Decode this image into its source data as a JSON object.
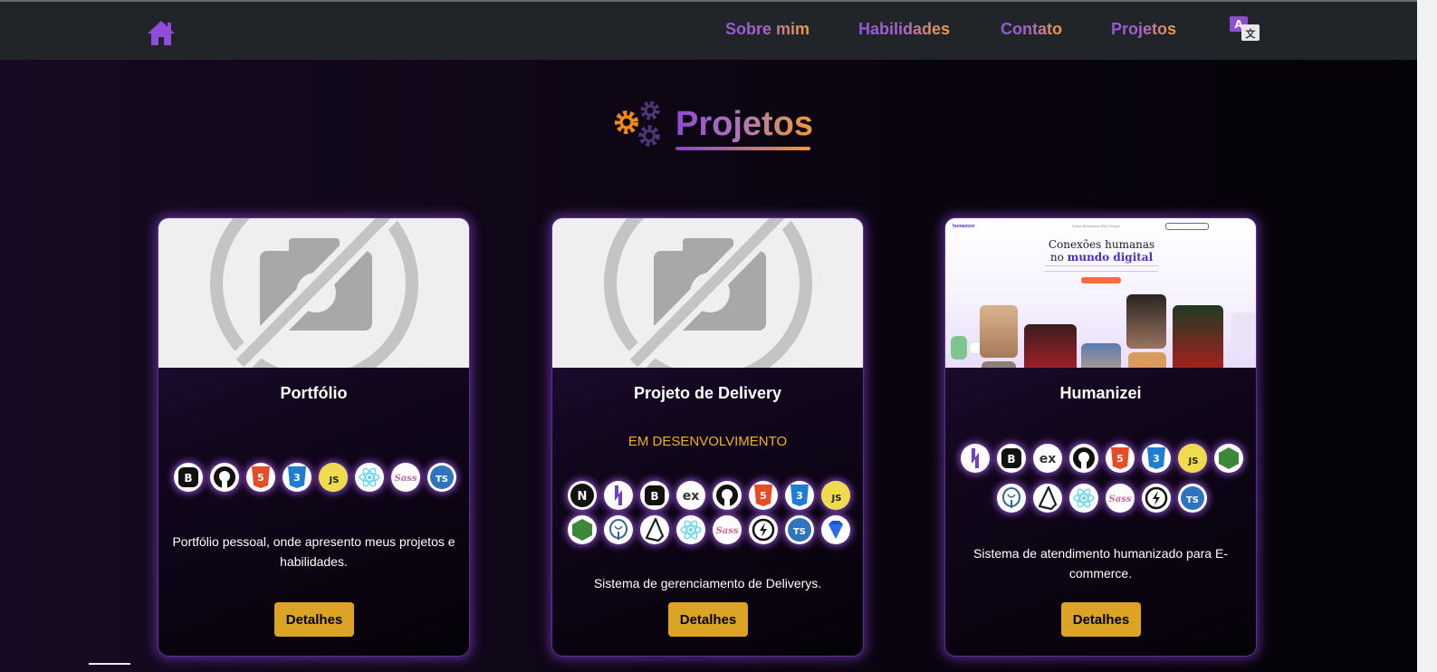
{
  "nav": {
    "links": [
      "Sobre mim",
      "Habilidades",
      "Contato",
      "Projetos"
    ]
  },
  "section": {
    "title": "Projetos"
  },
  "cards": [
    {
      "title": "Portfólio",
      "status": "",
      "tech": [
        "bootstrap-icon",
        "github-icon",
        "html5-icon",
        "css3-icon",
        "javascript-icon",
        "react-icon",
        "sass-icon",
        "typescript-icon"
      ],
      "description": "Portfólio pessoal, onde apresento meus projetos e habilidades.",
      "button": "Detalhes"
    },
    {
      "title": "Projeto de Delivery",
      "status": "EM DESENVOLVIMENTO",
      "tech": [
        "nextjs-icon",
        "heroku-icon",
        "bootstrap-icon",
        "express-icon",
        "github-icon",
        "html5-icon",
        "css3-icon",
        "javascript-icon",
        "nodejs-icon",
        "postgresql-icon",
        "prisma-icon",
        "react-icon",
        "sass-icon",
        "swagger-icon",
        "typescript-icon",
        "sapphire-icon"
      ],
      "description": "Sistema de gerenciamento de Deliverys.",
      "button": "Detalhes"
    },
    {
      "title": "Humanizei",
      "status": "",
      "tech": [
        "heroku-icon",
        "bootstrap-icon",
        "express-icon",
        "github-icon",
        "html5-icon",
        "css3-icon",
        "javascript-icon",
        "nodejs-icon",
        "postgresql-icon",
        "prisma-icon",
        "react-icon",
        "sass-icon",
        "swagger-icon",
        "typescript-icon"
      ],
      "description": "Sistema de atendimento humanizado para E-commerce.",
      "button": "Detalhes",
      "preview": {
        "logo": "humanizei",
        "menu": "Sobre  Benefícios  FAQ  Preços",
        "headline_1": "Conexões humanas",
        "headline_2_prefix": "no",
        "headline_2_highlight": "mundo digital"
      }
    }
  ],
  "colors": {
    "accent_purple": "#9356d6",
    "accent_orange": "#f2a23a",
    "button": "#dba425",
    "status": "#f2b11c"
  }
}
